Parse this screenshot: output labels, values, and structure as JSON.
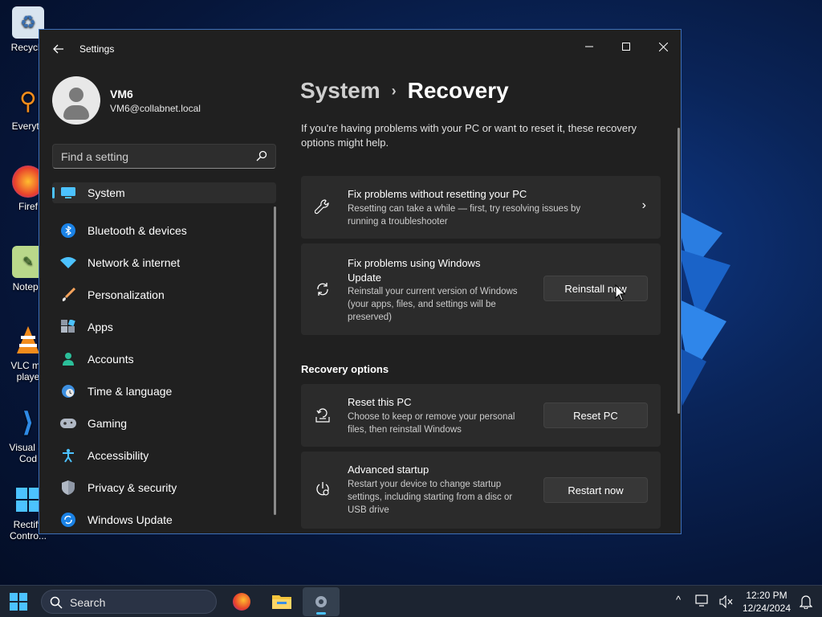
{
  "desktop": {
    "icons": [
      {
        "label": "Recycle",
        "icon": "recycle-bin-icon"
      },
      {
        "label": "Everyth",
        "icon": "everything-search-icon"
      },
      {
        "label": "Firef",
        "icon": "firefox-icon"
      },
      {
        "label": "Notepa",
        "icon": "notepad-icon"
      },
      {
        "label": "VLC me\nplaye",
        "icon": "vlc-icon"
      },
      {
        "label": "Visual St\nCod",
        "icon": "vscode-icon"
      },
      {
        "label": "Rectify\nContro...",
        "icon": "rectify11-icon"
      }
    ]
  },
  "window": {
    "title": "Settings",
    "controls": {
      "minimize": "—",
      "maximize": "☐",
      "close": "✕"
    }
  },
  "profile": {
    "name": "VM6",
    "email": "VM6@collabnet.local"
  },
  "search": {
    "placeholder": "Find a setting"
  },
  "nav": {
    "items": [
      {
        "label": "System",
        "icon": "monitor-icon",
        "active": true
      },
      {
        "label": "Bluetooth & devices",
        "icon": "bluetooth-icon"
      },
      {
        "label": "Network & internet",
        "icon": "wifi-icon"
      },
      {
        "label": "Personalization",
        "icon": "paintbrush-icon"
      },
      {
        "label": "Apps",
        "icon": "apps-icon"
      },
      {
        "label": "Accounts",
        "icon": "person-icon"
      },
      {
        "label": "Time & language",
        "icon": "clock-globe-icon"
      },
      {
        "label": "Gaming",
        "icon": "gamepad-icon"
      },
      {
        "label": "Accessibility",
        "icon": "accessibility-icon"
      },
      {
        "label": "Privacy & security",
        "icon": "shield-icon"
      },
      {
        "label": "Windows Update",
        "icon": "update-icon"
      }
    ]
  },
  "breadcrumb": {
    "parent": "System",
    "separator": "›",
    "current": "Recovery"
  },
  "intro": "If you're having problems with your PC or want to reset it, these recovery options might help.",
  "cards": {
    "fix_troubleshooter": {
      "title": "Fix problems without resetting your PC",
      "desc": "Resetting can take a while — first, try resolving issues by running a troubleshooter",
      "icon": "wrench-icon"
    },
    "fix_update": {
      "title": "Fix problems using Windows Update",
      "desc": "Reinstall your current version of Windows (your apps, files, and settings will be preserved)",
      "button": "Reinstall now",
      "icon": "sync-icon"
    }
  },
  "recovery_options": {
    "heading": "Recovery options",
    "reset": {
      "title": "Reset this PC",
      "desc": "Choose to keep or remove your personal files, then reinstall Windows",
      "button": "Reset PC",
      "icon": "reset-pc-icon"
    },
    "advanced": {
      "title": "Advanced startup",
      "desc": "Restart your device to change startup settings, including starting from a disc or USB drive",
      "button": "Restart now",
      "icon": "power-settings-icon"
    }
  },
  "taskbar": {
    "search_label": "Search",
    "time": "12:20 PM",
    "date": "12/24/2024"
  },
  "colors": {
    "accent": "#4cc2ff",
    "window_bg": "#202020",
    "card_bg": "#2b2b2b"
  }
}
